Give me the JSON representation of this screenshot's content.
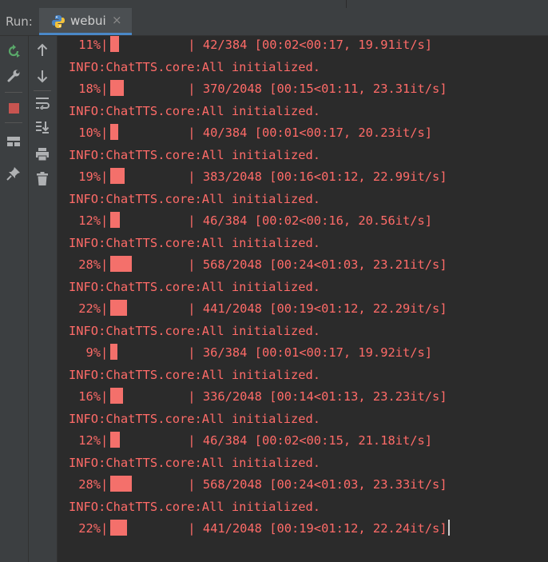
{
  "run_panel": {
    "run_label": "Run:",
    "tab": {
      "title": "webui",
      "close_glyph": "×",
      "icon": "python-icon"
    }
  },
  "toolbar_left": [
    {
      "name": "rerun-icon"
    },
    {
      "name": "wrench-icon"
    },
    {
      "name": "stop-icon"
    },
    {
      "name": "layout-icon"
    },
    {
      "name": "pin-icon"
    }
  ],
  "toolbar_right": [
    {
      "name": "arrow-up-icon"
    },
    {
      "name": "arrow-down-icon"
    },
    {
      "name": "soft-wrap-icon"
    },
    {
      "name": "scroll-to-end-icon"
    },
    {
      "name": "print-icon"
    },
    {
      "name": "trash-icon"
    }
  ],
  "console": {
    "text_color": "#ff6b68",
    "lines": [
      {
        "type": "progress",
        "pct": "11%",
        "fill": 0.11,
        "rest": "| 42/384 [00:02<00:17, 19.91it/s]"
      },
      {
        "type": "info",
        "text": "INFO:ChatTTS.core:All initialized."
      },
      {
        "type": "progress",
        "pct": "18%",
        "fill": 0.18,
        "rest": "| 370/2048 [00:15<01:11, 23.31it/s]"
      },
      {
        "type": "info",
        "text": "INFO:ChatTTS.core:All initialized."
      },
      {
        "type": "progress",
        "pct": "10%",
        "fill": 0.1,
        "rest": "| 40/384 [00:01<00:17, 20.23it/s]"
      },
      {
        "type": "info",
        "text": "INFO:ChatTTS.core:All initialized."
      },
      {
        "type": "progress",
        "pct": "19%",
        "fill": 0.19,
        "rest": "| 383/2048 [00:16<01:12, 22.99it/s]"
      },
      {
        "type": "info",
        "text": "INFO:ChatTTS.core:All initialized."
      },
      {
        "type": "progress",
        "pct": "12%",
        "fill": 0.12,
        "rest": "| 46/384 [00:02<00:16, 20.56it/s]"
      },
      {
        "type": "info",
        "text": "INFO:ChatTTS.core:All initialized."
      },
      {
        "type": "progress",
        "pct": "28%",
        "fill": 0.28,
        "rest": "| 568/2048 [00:24<01:03, 23.21it/s]"
      },
      {
        "type": "info",
        "text": "INFO:ChatTTS.core:All initialized."
      },
      {
        "type": "progress",
        "pct": "22%",
        "fill": 0.22,
        "rest": "| 441/2048 [00:19<01:12, 22.29it/s]"
      },
      {
        "type": "info",
        "text": "INFO:ChatTTS.core:All initialized."
      },
      {
        "type": "progress",
        "pct": "9%",
        "fill": 0.09,
        "rest": "| 36/384 [00:01<00:17, 19.92it/s]"
      },
      {
        "type": "info",
        "text": "INFO:ChatTTS.core:All initialized."
      },
      {
        "type": "progress",
        "pct": "16%",
        "fill": 0.16,
        "rest": "| 336/2048 [00:14<01:13, 23.23it/s]"
      },
      {
        "type": "info",
        "text": "INFO:ChatTTS.core:All initialized."
      },
      {
        "type": "progress",
        "pct": "12%",
        "fill": 0.12,
        "rest": "| 46/384 [00:02<00:15, 21.18it/s]"
      },
      {
        "type": "info",
        "text": "INFO:ChatTTS.core:All initialized."
      },
      {
        "type": "progress",
        "pct": "28%",
        "fill": 0.28,
        "rest": "| 568/2048 [00:24<01:03, 23.33it/s]"
      },
      {
        "type": "info",
        "text": "INFO:ChatTTS.core:All initialized."
      },
      {
        "type": "progress",
        "pct": "22%",
        "fill": 0.22,
        "rest": "| 441/2048 [00:19<01:12, 22.24it/s]"
      }
    ]
  }
}
